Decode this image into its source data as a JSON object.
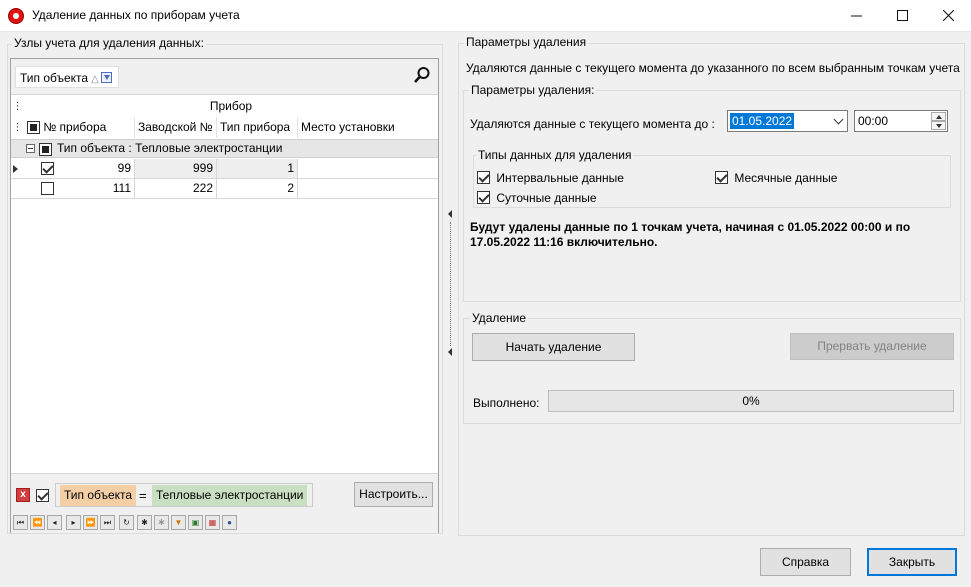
{
  "window": {
    "title": "Удаление данных по приборам учета"
  },
  "left": {
    "title": "Узлы учета для удаления данных:",
    "group_chip": "Тип объекта",
    "band_header": "Прибор",
    "columns": [
      "№ прибора",
      "Заводской №",
      "Тип прибора",
      "Место установки"
    ],
    "group_row": "Тип объекта : Тепловые электростанции",
    "rows": [
      {
        "checked": true,
        "num": "99",
        "factory": "999",
        "type": "1",
        "place": ""
      },
      {
        "checked": false,
        "num": "111",
        "factory": "222",
        "type": "2",
        "place": ""
      }
    ],
    "filter": {
      "field": "Тип объекта",
      "op": "=",
      "value": "Тепловые электростанции"
    },
    "configure_label": "Настроить..."
  },
  "right": {
    "title": "Параметры удаления",
    "description": "Удаляются данные с текущего момента до указанного по всем выбранным точкам учета",
    "params_title": "Параметры удаления:",
    "date_label": "Удаляются данные с текущего момента до :",
    "date_value": "01.05.2022",
    "time_value": "00:00",
    "types_title": "Типы данных для удаления",
    "types": {
      "interval": "Интервальные данные",
      "monthly": "Месячные данные",
      "daily": "Суточные данные"
    },
    "summary_line1": "Будут удалены данные по 1 точкам учета, начиная с 01.05.2022 00:00 и по",
    "summary_line2": "17.05.2022 11:16 включительно.",
    "delete_title": "Удаление",
    "start_label": "Начать удаление",
    "abort_label": "Прервать удаление",
    "progress_label": "Выполнено:",
    "progress_value": "0%"
  },
  "footer": {
    "help_label": "Справка",
    "close_label": "Закрыть"
  }
}
